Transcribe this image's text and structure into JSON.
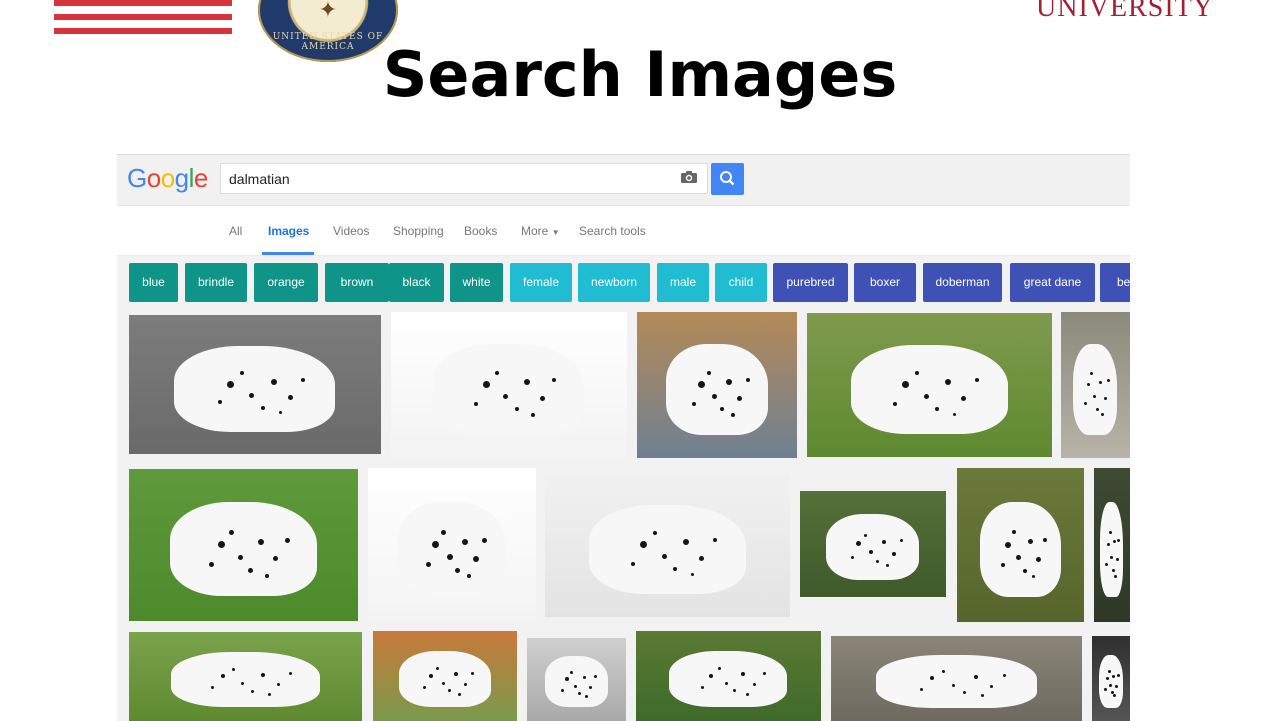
{
  "slide": {
    "title": "Search Images",
    "university": "UNIVERSITY"
  },
  "google": {
    "logo_letters": [
      "G",
      "o",
      "o",
      "g",
      "l",
      "e"
    ],
    "logo_colors": [
      "#4285f4",
      "#ea4335",
      "#fbbc05",
      "#4285f4",
      "#34a853",
      "#ea4335"
    ],
    "search_value": "dalmatian",
    "tabs": [
      {
        "label": "All",
        "active": false
      },
      {
        "label": "Images",
        "active": true
      },
      {
        "label": "Videos",
        "active": false
      },
      {
        "label": "Shopping",
        "active": false
      },
      {
        "label": "Books",
        "active": false
      },
      {
        "label": "More",
        "active": false
      },
      {
        "label": "Search tools",
        "active": false
      }
    ],
    "chips": [
      {
        "label": "blue",
        "color": "#0f9488"
      },
      {
        "label": "brindle",
        "color": "#0f9488"
      },
      {
        "label": "orange",
        "color": "#0f9488"
      },
      {
        "label": "brown",
        "color": "#0f9488"
      },
      {
        "label": "black",
        "color": "#0f9488"
      },
      {
        "label": "white",
        "color": "#0f9488"
      },
      {
        "label": "female",
        "color": "#1fbcd2"
      },
      {
        "label": "newborn",
        "color": "#1fbcd2"
      },
      {
        "label": "male",
        "color": "#1fbcd2"
      },
      {
        "label": "child",
        "color": "#1fbcd2"
      },
      {
        "label": "purebred",
        "color": "#3f51b5"
      },
      {
        "label": "boxer",
        "color": "#3f51b5"
      },
      {
        "label": "doberman",
        "color": "#3f51b5"
      },
      {
        "label": "great dane",
        "color": "#3f51b5"
      },
      {
        "label": "beagle",
        "color": "#3f51b5"
      }
    ]
  },
  "colors": {
    "search_button": "#4285f4",
    "accent_tab": "#1a73e8",
    "university_red": "#a31f34",
    "flag_red": "#d8323c"
  },
  "icons": [
    "camera-icon",
    "search-icon",
    "chevron-down-icon"
  ]
}
